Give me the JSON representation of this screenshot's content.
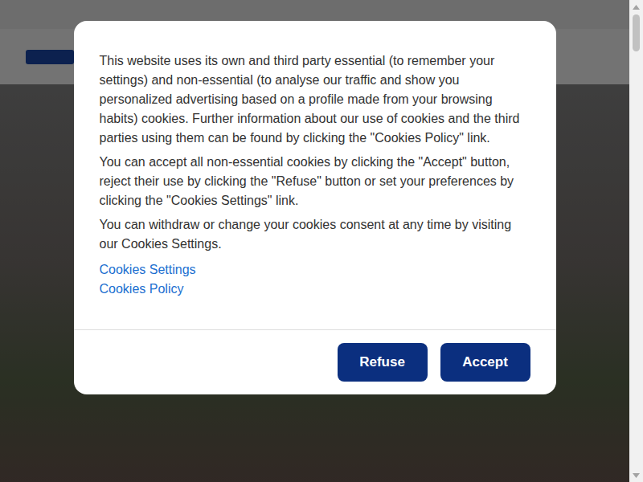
{
  "cookie_dialog": {
    "paragraphs": [
      "This website uses its own and third party essential (to remember your settings) and non-essential (to analyse our traffic and show you personalized advertising based on a profile made from your browsing habits) cookies. Further information about our use of cookies and the third parties using them can be found by clicking the \"Cookies Policy\" link.",
      "You can accept all non-essential cookies by clicking the \"Accept\" button, reject their use by clicking the \"Refuse\" button or set your preferences by clicking the \"Cookies Settings\" link.",
      "You can withdraw or change your cookies consent at any time by visiting our Cookies Settings."
    ],
    "links": [
      "Cookies Settings",
      "Cookies Policy"
    ],
    "buttons": [
      "Refuse",
      "Accept"
    ]
  }
}
